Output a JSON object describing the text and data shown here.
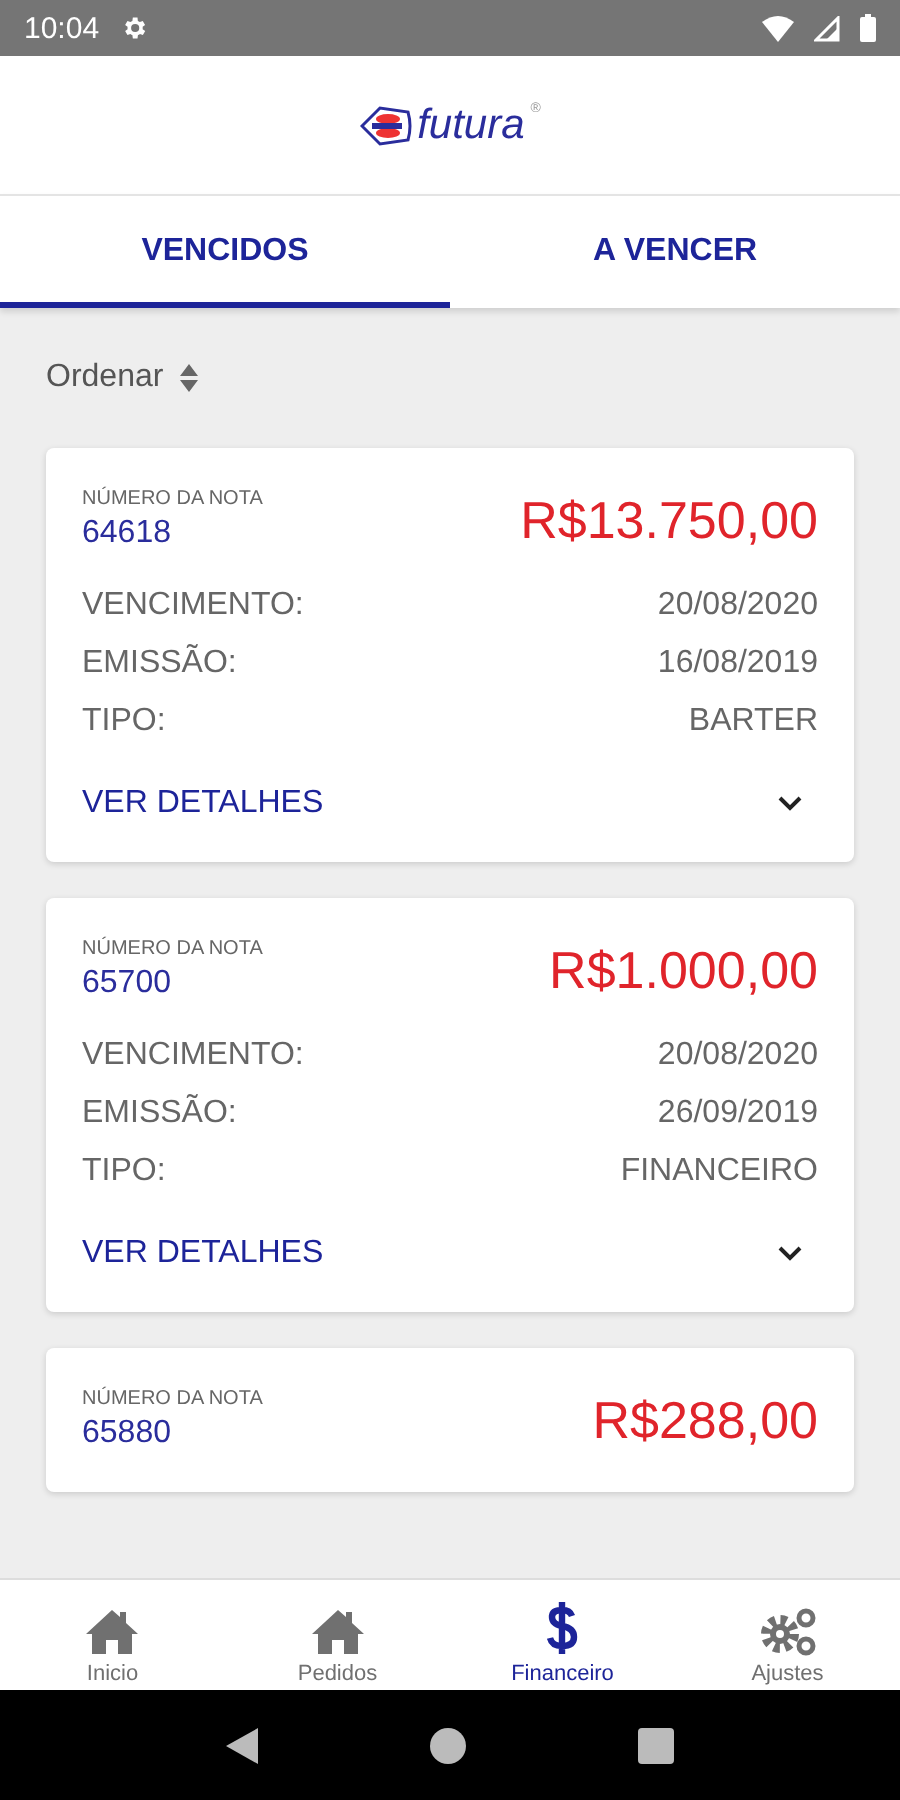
{
  "status_bar": {
    "time": "10:04"
  },
  "header": {
    "logo_text": "futura",
    "logo_mark": "®"
  },
  "tabs": [
    {
      "label": "VENCIDOS",
      "selected": true
    },
    {
      "label": "A VENCER",
      "selected": false
    }
  ],
  "sort": {
    "label": "Ordenar"
  },
  "cards": [
    {
      "number_label": "NÚMERO DA NOTA",
      "number": "64618",
      "amount": "R$13.750,00",
      "rows": [
        {
          "label": "VENCIMENTO:",
          "value": "20/08/2020"
        },
        {
          "label": "EMISSÃO:",
          "value": "16/08/2019"
        },
        {
          "label": "TIPO:",
          "value": "BARTER"
        }
      ],
      "details": "VER DETALHES"
    },
    {
      "number_label": "NÚMERO DA NOTA",
      "number": "65700",
      "amount": "R$1.000,00",
      "rows": [
        {
          "label": "VENCIMENTO:",
          "value": "20/08/2020"
        },
        {
          "label": "EMISSÃO:",
          "value": "26/09/2019"
        },
        {
          "label": "TIPO:",
          "value": "FINANCEIRO"
        }
      ],
      "details": "VER DETALHES"
    },
    {
      "number_label": "NÚMERO DA NOTA",
      "number": "65880",
      "amount": "R$288,00"
    }
  ],
  "bottom_nav": [
    {
      "label": "Inicio",
      "kind": "home",
      "selected": false
    },
    {
      "label": "Pedidos",
      "kind": "home",
      "selected": false
    },
    {
      "label": "Financeiro",
      "kind": "dollar",
      "selected": true
    },
    {
      "label": "Ajustes",
      "kind": "gears",
      "selected": false
    }
  ]
}
